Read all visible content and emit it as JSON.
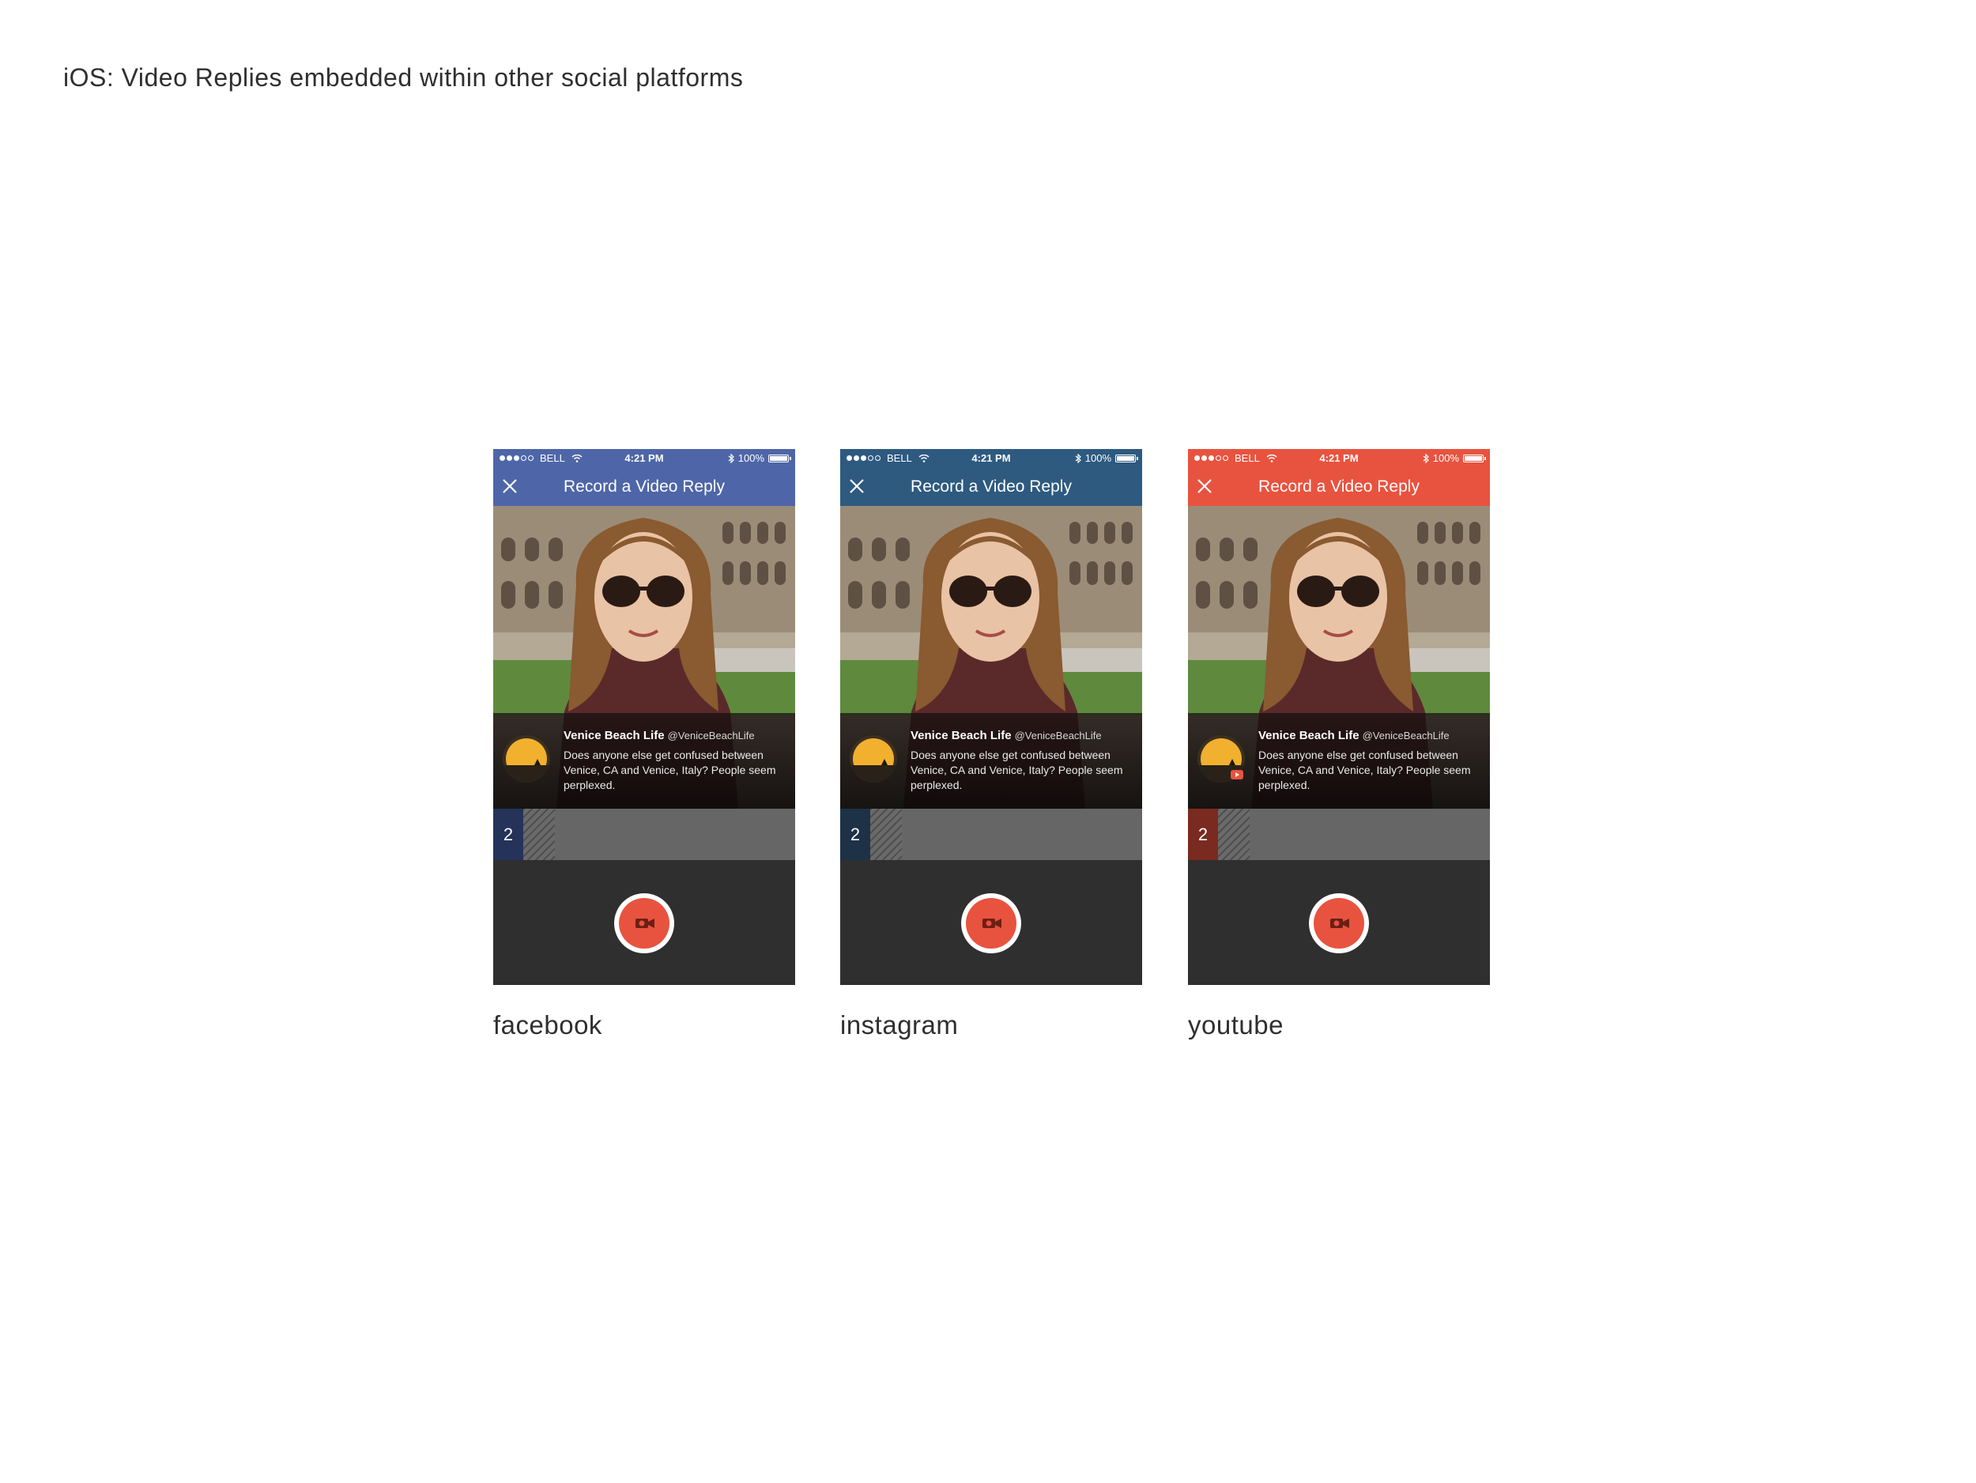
{
  "page": {
    "title": "iOS: Video Replies embedded within other social platforms"
  },
  "status_bar": {
    "carrier": "BELL",
    "time": "4:21 PM",
    "battery": "100%"
  },
  "screen": {
    "nav_title": "Record a Video Reply",
    "post": {
      "name": "Venice Beach Life",
      "handle": "@VeniceBeachLife",
      "text": "Does anyone else get confused between Venice, CA and Venice, Italy? People seem perplexed."
    },
    "reply_count": "2"
  },
  "platforms": [
    {
      "label": "facebook",
      "header_color": "#4e66a8",
      "count_color": "#25325a"
    },
    {
      "label": "instagram",
      "header_color": "#2e5a80",
      "count_color": "#1d3147"
    },
    {
      "label": "youtube",
      "header_color": "#e8533f",
      "count_color": "#7a2a1f"
    }
  ],
  "icons": {
    "close": "close-icon",
    "record": "video-camera-icon",
    "wifi": "wifi-icon",
    "bluetooth": "bluetooth-icon",
    "battery": "battery-icon"
  },
  "colors": {
    "record_button": "#e8533f",
    "record_ring": "#ffffff",
    "counter_bar": "#666666",
    "body_bg": "#2f2f2f"
  }
}
